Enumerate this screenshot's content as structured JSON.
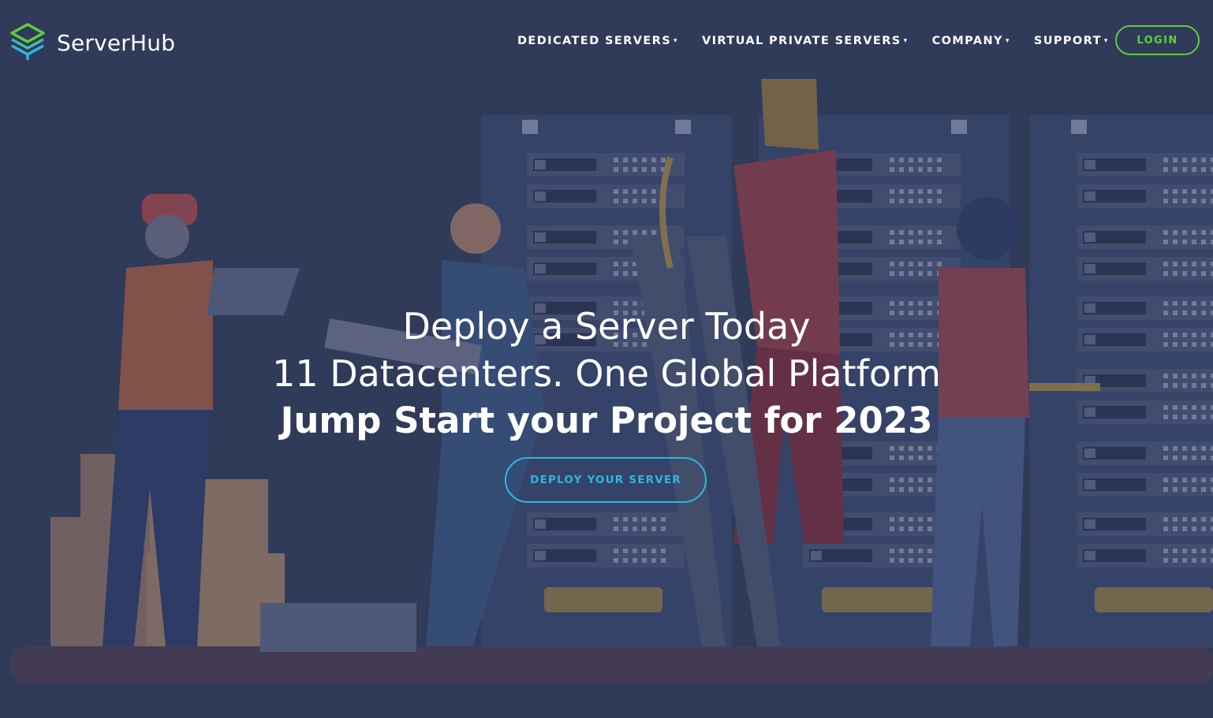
{
  "brand": {
    "name": "ServerHub",
    "logo_icon": "stacked-layers-icon",
    "accent_green": "#5fcd3c",
    "accent_blue": "#2eb7de"
  },
  "nav": {
    "items": [
      {
        "label": "DEDICATED SERVERS"
      },
      {
        "label": "VIRTUAL PRIVATE SERVERS"
      },
      {
        "label": "COMPANY"
      },
      {
        "label": "SUPPORT"
      }
    ],
    "caret": "▾",
    "login_label": "LOGIN"
  },
  "hero": {
    "line1": "Deploy a Server Today",
    "line2": "11 Datacenters. One Global Platform",
    "line3": "Jump Start your Project for 2023",
    "cta_label": "DEPLOY YOUR SERVER",
    "background": "#323c5a"
  }
}
